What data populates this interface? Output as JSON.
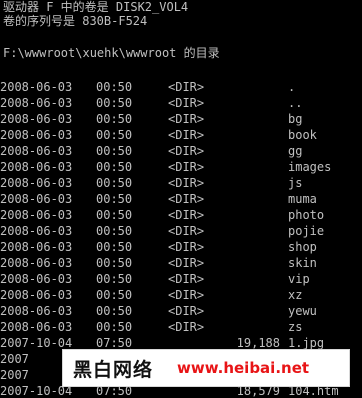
{
  "console": {
    "volume_line": "驱动器 F 中的卷是 DISK2_VOL4",
    "serial_line": "卷的序列号是 830B-F524",
    "directory_line": "F:\\wwwroot\\xuehk\\wwwroot 的目录"
  },
  "entries": [
    {
      "date": "2008-06-03",
      "time": "00:50",
      "type": "<DIR>",
      "size": "",
      "name": "."
    },
    {
      "date": "2008-06-03",
      "time": "00:50",
      "type": "<DIR>",
      "size": "",
      "name": ".."
    },
    {
      "date": "2008-06-03",
      "time": "00:50",
      "type": "<DIR>",
      "size": "",
      "name": "bg"
    },
    {
      "date": "2008-06-03",
      "time": "00:50",
      "type": "<DIR>",
      "size": "",
      "name": "book"
    },
    {
      "date": "2008-06-03",
      "time": "00:50",
      "type": "<DIR>",
      "size": "",
      "name": "gg"
    },
    {
      "date": "2008-06-03",
      "time": "00:50",
      "type": "<DIR>",
      "size": "",
      "name": "images"
    },
    {
      "date": "2008-06-03",
      "time": "00:50",
      "type": "<DIR>",
      "size": "",
      "name": "js"
    },
    {
      "date": "2008-06-03",
      "time": "00:50",
      "type": "<DIR>",
      "size": "",
      "name": "muma"
    },
    {
      "date": "2008-06-03",
      "time": "00:50",
      "type": "<DIR>",
      "size": "",
      "name": "photo"
    },
    {
      "date": "2008-06-03",
      "time": "00:50",
      "type": "<DIR>",
      "size": "",
      "name": "pojie"
    },
    {
      "date": "2008-06-03",
      "time": "00:50",
      "type": "<DIR>",
      "size": "",
      "name": "shop"
    },
    {
      "date": "2008-06-03",
      "time": "00:50",
      "type": "<DIR>",
      "size": "",
      "name": "skin"
    },
    {
      "date": "2008-06-03",
      "time": "00:50",
      "type": "<DIR>",
      "size": "",
      "name": "vip"
    },
    {
      "date": "2008-06-03",
      "time": "00:50",
      "type": "<DIR>",
      "size": "",
      "name": "xz"
    },
    {
      "date": "2008-06-03",
      "time": "00:50",
      "type": "<DIR>",
      "size": "",
      "name": "yewu"
    },
    {
      "date": "2008-06-03",
      "time": "00:50",
      "type": "<DIR>",
      "size": "",
      "name": "zs"
    },
    {
      "date": "2007-10-04",
      "time": "07:50",
      "type": "",
      "size": "19,188",
      "name": "1.jpg"
    },
    {
      "date": "2007",
      "time": "",
      "type": "",
      "size": "",
      "name": ""
    },
    {
      "date": "2007",
      "time": "",
      "type": "",
      "size": "",
      "name": ""
    },
    {
      "date": "2007-10-04",
      "time": "07:50",
      "type": "",
      "size": "18,579",
      "name": "104.htm"
    }
  ],
  "watermark": {
    "brand": "黑白网络",
    "url": "www.heibai.net",
    "url_color": "#e81416"
  },
  "colors": {
    "background": "#000000",
    "text": "#c0c0c0"
  }
}
